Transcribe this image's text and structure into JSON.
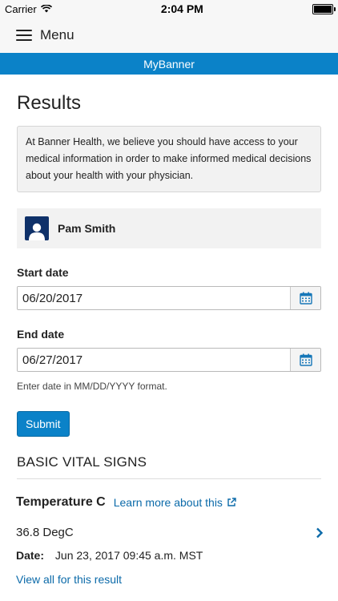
{
  "status_bar": {
    "carrier": "Carrier",
    "time": "2:04 PM"
  },
  "nav": {
    "menu_label": "Menu"
  },
  "brand": {
    "title": "MyBanner",
    "color": "#0b82c8"
  },
  "page": {
    "title": "Results",
    "info_text": "At Banner Health, we believe you should have access to your medical information in order to make informed medical decisions about your health with your physician."
  },
  "patient": {
    "name": "Pam Smith",
    "avatar_color": "#0f3169"
  },
  "form": {
    "start_label": "Start date",
    "start_value": "06/20/2017",
    "end_label": "End date",
    "end_value": "06/27/2017",
    "hint": "Enter date in MM/DD/YYYY format.",
    "submit_label": "Submit"
  },
  "section": {
    "title": "BASIC VITAL SIGNS"
  },
  "result": {
    "name": "Temperature C",
    "learn_more": "Learn more about this",
    "value": "36.8 DegC",
    "date_label": "Date:",
    "date_value": "Jun 23, 2017 09:45 a.m. MST",
    "view_all": "View all for this result"
  },
  "icons": {
    "menu": "hamburger-icon",
    "calendar": "calendar-icon",
    "external": "external-link-icon",
    "chevron": "chevron-right-icon",
    "avatar": "user-icon"
  }
}
